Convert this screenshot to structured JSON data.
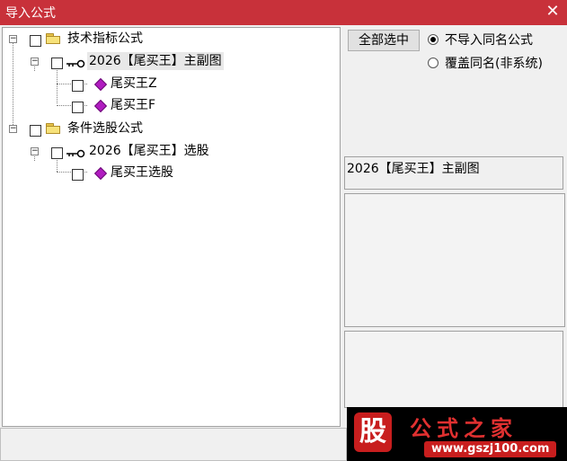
{
  "window": {
    "title": "导入公式",
    "close_glyph": "✕"
  },
  "tree": {
    "items": [
      {
        "label": "技术指标公式",
        "icon": "folder-icon"
      },
      {
        "label": "2026【尾买王】主副图",
        "icon": "key-icon"
      },
      {
        "label": "尾买王Z",
        "icon": "diamond-icon"
      },
      {
        "label": "尾买王F",
        "icon": "diamond-icon"
      },
      {
        "label": "条件选股公式",
        "icon": "folder-icon"
      },
      {
        "label": "2026【尾买王】选股",
        "icon": "key-icon"
      },
      {
        "label": "尾买王选股",
        "icon": "diamond-icon"
      }
    ]
  },
  "controls": {
    "select_all_label": "全部选中",
    "radio_skip_label": "不导入同名公式",
    "radio_overwrite_label": "覆盖同名(非系统)",
    "radio_selected": "skip"
  },
  "detail": {
    "formula_name": "2026【尾买王】主副图"
  },
  "watermark": {
    "badge": "股",
    "name": "公式之家",
    "url": "www.gszj100.com"
  },
  "colors": {
    "title_bar": "#c8313a",
    "accent_diamond": "#b01cc0"
  }
}
